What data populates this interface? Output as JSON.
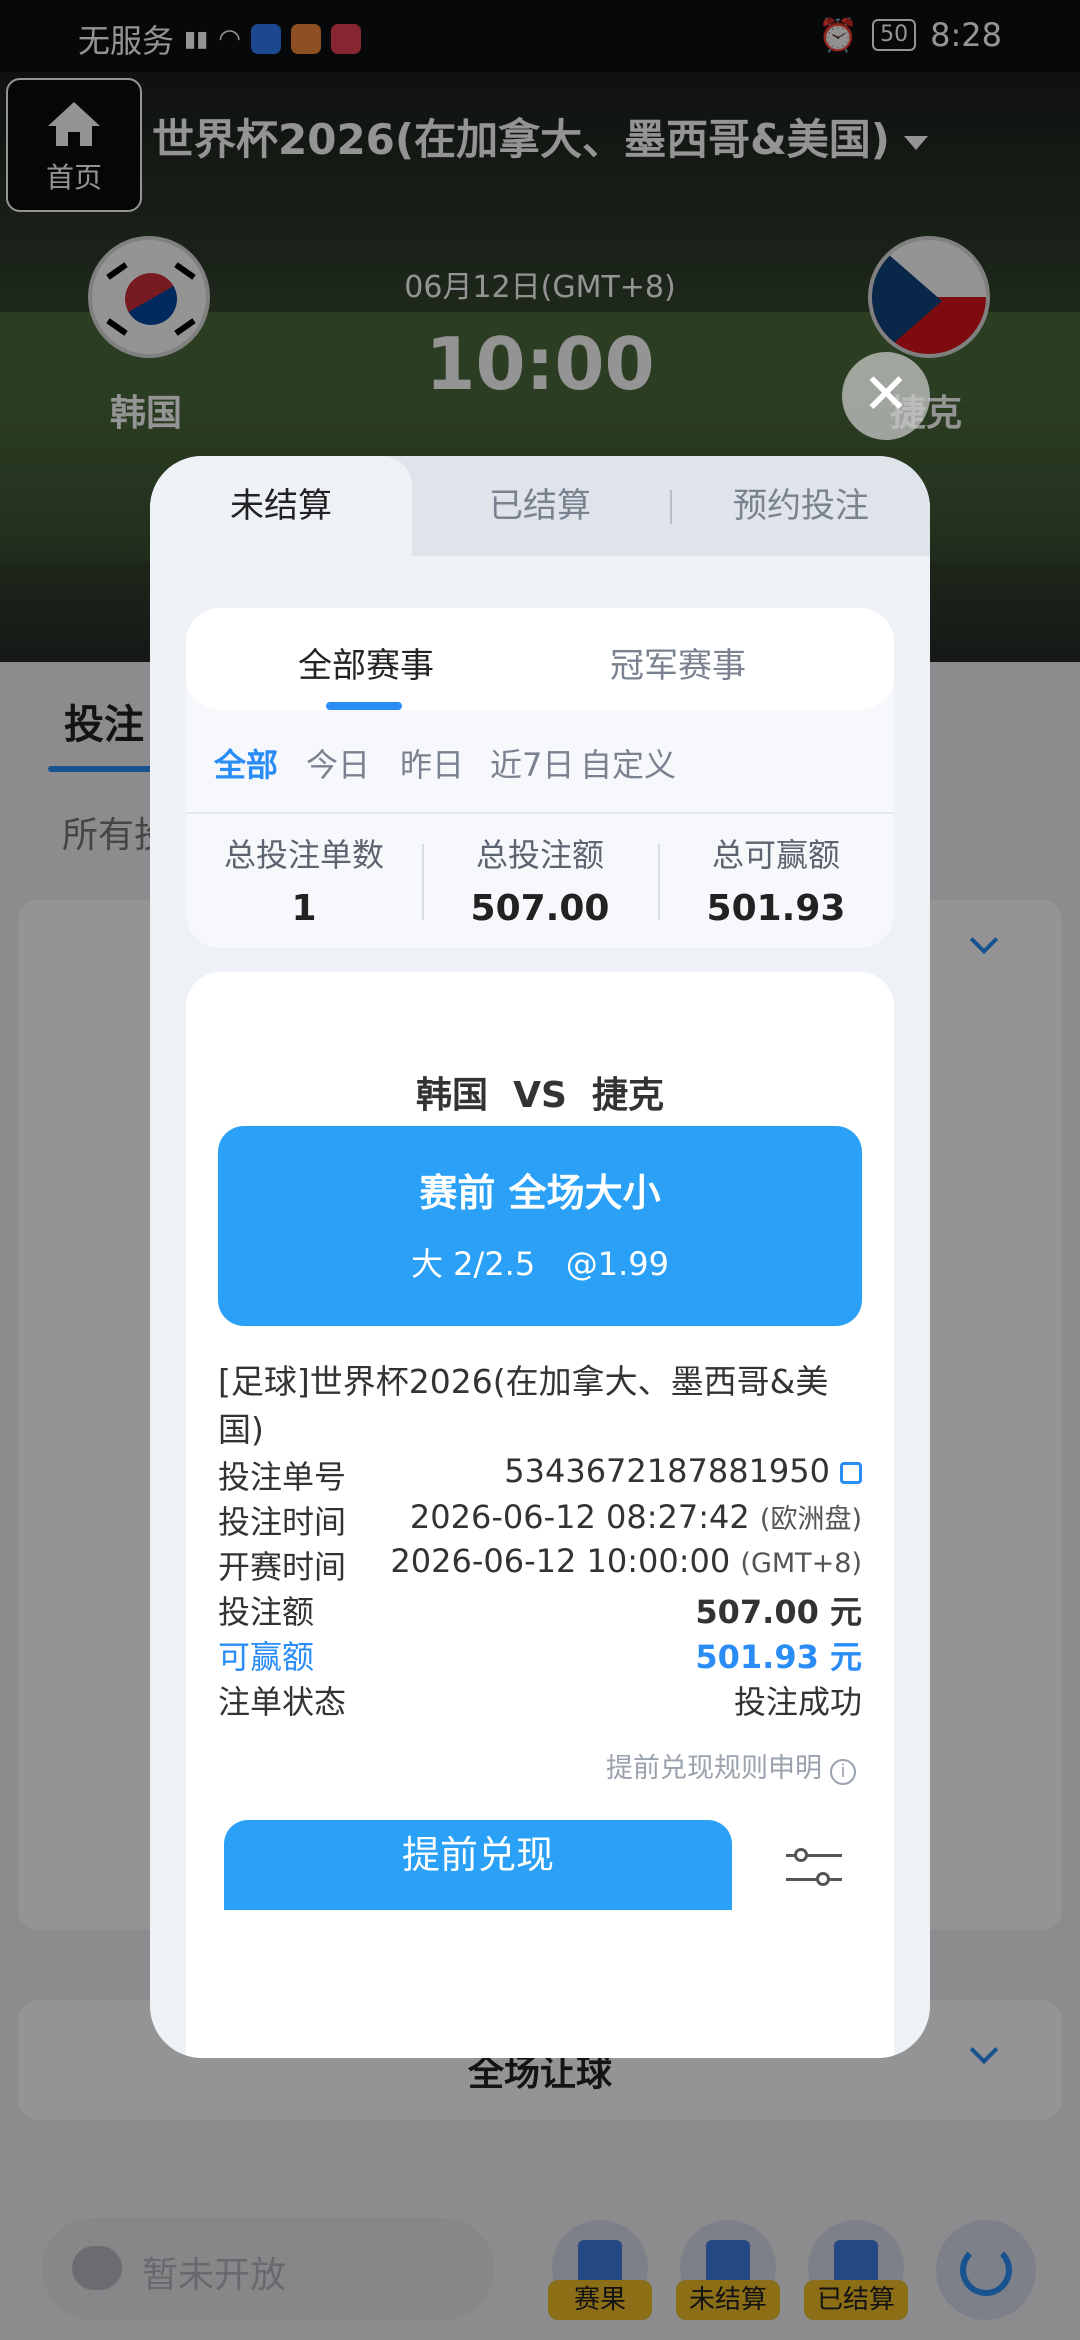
{
  "status_bar": {
    "carrier": "无服务",
    "battery": "50",
    "time": "8:28"
  },
  "header": {
    "home_label": "首页",
    "league_title": "世界杯2026(在加拿大、墨西哥&美国)"
  },
  "match": {
    "home_team": "韩国",
    "away_team": "捷克",
    "date": "06月12日(GMT+8)",
    "time": "10:00"
  },
  "background": {
    "tab_label": "投注",
    "filter_label": "所有投",
    "section_title": "全场让球",
    "chat_placeholder": "暂未开放",
    "quick_buttons": [
      "赛果",
      "未结算",
      "已结算"
    ]
  },
  "modal": {
    "tabs": [
      "未结算",
      "已结算",
      "预约投注"
    ],
    "sub_tabs": [
      "全部赛事",
      "冠军赛事"
    ],
    "ranges": [
      "全部",
      "今日",
      "昨日",
      "近7日",
      "自定义"
    ],
    "stats": [
      {
        "label": "总投注单数",
        "value": "1"
      },
      {
        "label": "总投注额",
        "value": "507.00"
      },
      {
        "label": "总可赢额",
        "value": "501.93"
      }
    ],
    "bet": {
      "match_title": "韩国  VS  捷克",
      "market": "赛前 全场大小",
      "pick": "大 2/2.5   @1.99",
      "league": "[足球]世界杯2026(在加拿大、墨西哥&美国)",
      "rows": [
        {
          "key": "投注单号",
          "value": "5343672187881950",
          "suffix": ""
        },
        {
          "key": "投注时间",
          "value": "2026-06-12 08:27:42",
          "suffix": "(欧洲盘)"
        },
        {
          "key": "开赛时间",
          "value": "2026-06-12 10:00:00",
          "suffix": "(GMT+8)"
        },
        {
          "key": "投注额",
          "value": "507.00 元",
          "suffix": ""
        },
        {
          "key": "可赢额",
          "value": "501.93 元",
          "suffix": ""
        },
        {
          "key": "注单状态",
          "value": "投注成功",
          "suffix": ""
        }
      ],
      "rules_link": "提前兑现规则申明",
      "cashout_label": "提前兑现"
    }
  },
  "colors": {
    "accent": "#2a8df6",
    "banner": "#2aa1f6",
    "tag_yellow": "#f2be26"
  }
}
